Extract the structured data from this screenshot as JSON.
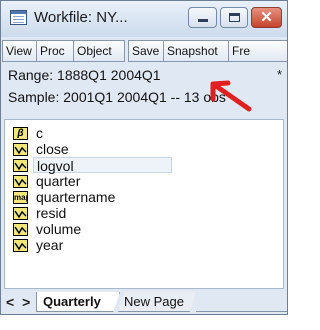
{
  "window": {
    "title": "Workfile: NY...",
    "buttons": {
      "close_glyph": "✕"
    }
  },
  "toolbar": {
    "buttons": [
      "View",
      "Proc",
      "Object",
      "Save",
      "Snapshot",
      "Fre"
    ]
  },
  "info": {
    "range": "Range:  1888Q1 2004Q1",
    "range_marker": "*",
    "sample": "Sample: 2001Q1 2004Q1  --  13 obs"
  },
  "objects": [
    {
      "name": "c",
      "type": "coef",
      "icon_text": "β"
    },
    {
      "name": "close",
      "type": "series"
    },
    {
      "name": "logvol",
      "type": "series",
      "selected": true
    },
    {
      "name": "quarter",
      "type": "series"
    },
    {
      "name": "quartername",
      "type": "alpha",
      "icon_text": "map"
    },
    {
      "name": "resid",
      "type": "series"
    },
    {
      "name": "volume",
      "type": "series"
    },
    {
      "name": "year",
      "type": "series"
    }
  ],
  "tabs": {
    "scroll": "< >",
    "active": "Quarterly",
    "other": "New Page"
  },
  "annotation": {
    "color": "#e02020"
  }
}
